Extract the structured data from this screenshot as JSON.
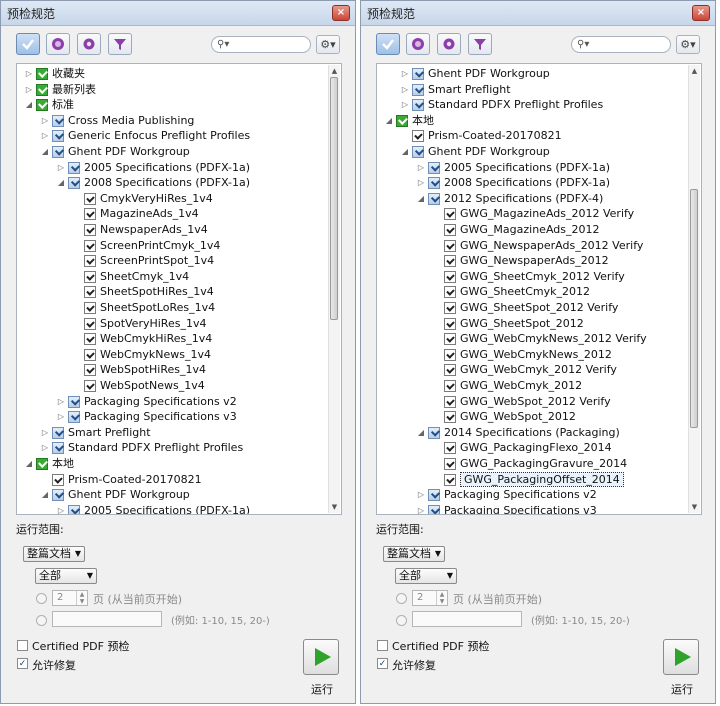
{
  "panels": [
    {
      "title": "预检规范",
      "search": {
        "placeholder": ""
      },
      "tree": {
        "rows": [
          {
            "depth": 0,
            "exp": "▷",
            "icon": "green",
            "label": "收藏夹",
            "selected": false
          },
          {
            "depth": 0,
            "exp": "▷",
            "icon": "green",
            "label": "最新列表",
            "selected": false
          },
          {
            "depth": 0,
            "exp": "◢",
            "icon": "green",
            "label": "标准",
            "selected": false
          },
          {
            "depth": 1,
            "exp": "▷",
            "icon": "group",
            "label": "Cross Media Publishing",
            "selected": false
          },
          {
            "depth": 1,
            "exp": "▷",
            "icon": "group",
            "label": "Generic Enfocus Preflight Profiles",
            "selected": false
          },
          {
            "depth": 1,
            "exp": "◢",
            "icon": "group",
            "label": "Ghent PDF Workgroup",
            "selected": false
          },
          {
            "depth": 2,
            "exp": "▷",
            "icon": "group",
            "label": "2005 Specifications (PDFX-1a)",
            "selected": false
          },
          {
            "depth": 2,
            "exp": "◢",
            "icon": "group",
            "label": "2008 Specifications (PDFX-1a)",
            "selected": false
          },
          {
            "depth": 3,
            "exp": "",
            "icon": "doc",
            "label": "CmykVeryHiRes_1v4",
            "selected": false
          },
          {
            "depth": 3,
            "exp": "",
            "icon": "doc",
            "label": "MagazineAds_1v4",
            "selected": false
          },
          {
            "depth": 3,
            "exp": "",
            "icon": "doc",
            "label": "NewspaperAds_1v4",
            "selected": false
          },
          {
            "depth": 3,
            "exp": "",
            "icon": "doc",
            "label": "ScreenPrintCmyk_1v4",
            "selected": false
          },
          {
            "depth": 3,
            "exp": "",
            "icon": "doc",
            "label": "ScreenPrintSpot_1v4",
            "selected": false
          },
          {
            "depth": 3,
            "exp": "",
            "icon": "doc",
            "label": "SheetCmyk_1v4",
            "selected": false
          },
          {
            "depth": 3,
            "exp": "",
            "icon": "doc",
            "label": "SheetSpotHiRes_1v4",
            "selected": false
          },
          {
            "depth": 3,
            "exp": "",
            "icon": "doc",
            "label": "SheetSpotLoRes_1v4",
            "selected": false
          },
          {
            "depth": 3,
            "exp": "",
            "icon": "doc",
            "label": "SpotVeryHiRes_1v4",
            "selected": false
          },
          {
            "depth": 3,
            "exp": "",
            "icon": "doc",
            "label": "WebCmykHiRes_1v4",
            "selected": false
          },
          {
            "depth": 3,
            "exp": "",
            "icon": "doc",
            "label": "WebCmykNews_1v4",
            "selected": false
          },
          {
            "depth": 3,
            "exp": "",
            "icon": "doc",
            "label": "WebSpotHiRes_1v4",
            "selected": false
          },
          {
            "depth": 3,
            "exp": "",
            "icon": "doc",
            "label": "WebSpotNews_1v4",
            "selected": false
          },
          {
            "depth": 2,
            "exp": "▷",
            "icon": "group",
            "label": "Packaging Specifications v2",
            "selected": false
          },
          {
            "depth": 2,
            "exp": "▷",
            "icon": "group",
            "label": "Packaging Specifications v3",
            "selected": false
          },
          {
            "depth": 1,
            "exp": "▷",
            "icon": "group",
            "label": "Smart Preflight",
            "selected": false
          },
          {
            "depth": 1,
            "exp": "▷",
            "icon": "group",
            "label": "Standard PDFX Preflight Profiles",
            "selected": false
          },
          {
            "depth": 0,
            "exp": "◢",
            "icon": "green",
            "label": "本地",
            "selected": false
          },
          {
            "depth": 1,
            "exp": "",
            "icon": "doc",
            "label": "Prism-Coated-20170821",
            "selected": false
          },
          {
            "depth": 1,
            "exp": "◢",
            "icon": "group",
            "label": "Ghent PDF Workgroup",
            "selected": false
          },
          {
            "depth": 2,
            "exp": "▷",
            "icon": "group",
            "label": "2005 Specifications (PDFX-1a)",
            "selected": false
          }
        ],
        "scroll_fraction": 0.0,
        "thumb_ratio": 0.57
      },
      "run_range_label": "运行范围:",
      "scope_select": "整篇文档",
      "pages_select": "全部",
      "page_spin_value": "2",
      "page_from_current": "页 (从当前页开始)",
      "example_hint": "(例如: 1-10, 15, 20-)",
      "certified_label": "Certified PDF 预检",
      "certified_checked": false,
      "allow_fix_label": "允许修复",
      "allow_fix_checked": true,
      "run_label": "运行"
    },
    {
      "title": "预检规范",
      "search": {
        "placeholder": ""
      },
      "tree": {
        "rows": [
          {
            "depth": 1,
            "exp": "▷",
            "icon": "group",
            "label": "Ghent PDF Workgroup",
            "selected": false
          },
          {
            "depth": 1,
            "exp": "▷",
            "icon": "group",
            "label": "Smart Preflight",
            "selected": false
          },
          {
            "depth": 1,
            "exp": "▷",
            "icon": "group",
            "label": "Standard PDFX Preflight Profiles",
            "selected": false
          },
          {
            "depth": 0,
            "exp": "◢",
            "icon": "green",
            "label": "本地",
            "selected": false
          },
          {
            "depth": 1,
            "exp": "",
            "icon": "doc",
            "label": "Prism-Coated-20170821",
            "selected": false
          },
          {
            "depth": 1,
            "exp": "◢",
            "icon": "group",
            "label": "Ghent PDF Workgroup",
            "selected": false
          },
          {
            "depth": 2,
            "exp": "▷",
            "icon": "group",
            "label": "2005 Specifications (PDFX-1a)",
            "selected": false
          },
          {
            "depth": 2,
            "exp": "▷",
            "icon": "group",
            "label": "2008 Specifications (PDFX-1a)",
            "selected": false
          },
          {
            "depth": 2,
            "exp": "◢",
            "icon": "group",
            "label": "2012 Specifications (PDFX-4)",
            "selected": false
          },
          {
            "depth": 3,
            "exp": "",
            "icon": "doc",
            "label": "GWG_MagazineAds_2012 Verify",
            "selected": false
          },
          {
            "depth": 3,
            "exp": "",
            "icon": "doc",
            "label": "GWG_MagazineAds_2012",
            "selected": false
          },
          {
            "depth": 3,
            "exp": "",
            "icon": "doc",
            "label": "GWG_NewspaperAds_2012 Verify",
            "selected": false
          },
          {
            "depth": 3,
            "exp": "",
            "icon": "doc",
            "label": "GWG_NewspaperAds_2012",
            "selected": false
          },
          {
            "depth": 3,
            "exp": "",
            "icon": "doc",
            "label": "GWG_SheetCmyk_2012 Verify",
            "selected": false
          },
          {
            "depth": 3,
            "exp": "",
            "icon": "doc",
            "label": "GWG_SheetCmyk_2012",
            "selected": false
          },
          {
            "depth": 3,
            "exp": "",
            "icon": "doc",
            "label": "GWG_SheetSpot_2012 Verify",
            "selected": false
          },
          {
            "depth": 3,
            "exp": "",
            "icon": "doc",
            "label": "GWG_SheetSpot_2012",
            "selected": false
          },
          {
            "depth": 3,
            "exp": "",
            "icon": "doc",
            "label": "GWG_WebCmykNews_2012 Verify",
            "selected": false
          },
          {
            "depth": 3,
            "exp": "",
            "icon": "doc",
            "label": "GWG_WebCmykNews_2012",
            "selected": false
          },
          {
            "depth": 3,
            "exp": "",
            "icon": "doc",
            "label": "GWG_WebCmyk_2012 Verify",
            "selected": false
          },
          {
            "depth": 3,
            "exp": "",
            "icon": "doc",
            "label": "GWG_WebCmyk_2012",
            "selected": false
          },
          {
            "depth": 3,
            "exp": "",
            "icon": "doc",
            "label": "GWG_WebSpot_2012 Verify",
            "selected": false
          },
          {
            "depth": 3,
            "exp": "",
            "icon": "doc",
            "label": "GWG_WebSpot_2012",
            "selected": false
          },
          {
            "depth": 2,
            "exp": "◢",
            "icon": "group",
            "label": "2014 Specifications (Packaging)",
            "selected": false
          },
          {
            "depth": 3,
            "exp": "",
            "icon": "doc",
            "label": "GWG_PackagingFlexo_2014",
            "selected": false
          },
          {
            "depth": 3,
            "exp": "",
            "icon": "doc",
            "label": "GWG_PackagingGravure_2014",
            "selected": false
          },
          {
            "depth": 3,
            "exp": "",
            "icon": "doc",
            "label": "GWG_PackagingOffset_2014",
            "selected": true
          },
          {
            "depth": 2,
            "exp": "▷",
            "icon": "group",
            "label": "Packaging Specifications v2",
            "selected": false
          },
          {
            "depth": 2,
            "exp": "▷",
            "icon": "group",
            "label": "Packaging Specifications v3",
            "selected": false
          }
        ],
        "scroll_fraction": 0.6,
        "thumb_ratio": 0.56
      },
      "run_range_label": "运行范围:",
      "scope_select": "整篇文档",
      "pages_select": "全部",
      "page_spin_value": "2",
      "page_from_current": "页 (从当前页开始)",
      "example_hint": "(例如: 1-10, 15, 20-)",
      "certified_label": "Certified PDF 预检",
      "certified_checked": false,
      "allow_fix_label": "允许修复",
      "allow_fix_checked": true,
      "run_label": "运行"
    }
  ]
}
